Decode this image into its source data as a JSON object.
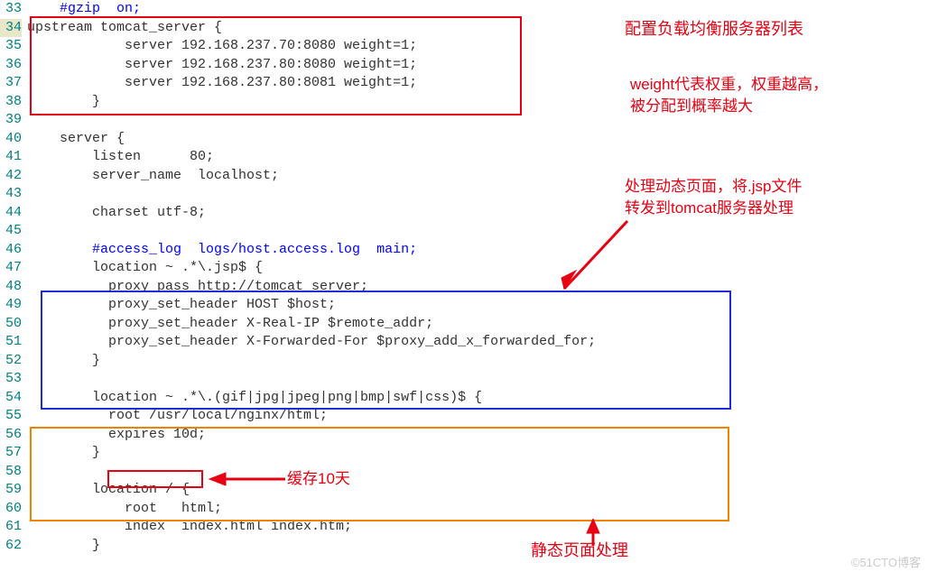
{
  "line_numbers": {
    "start": 33,
    "end": 62,
    "highlight": 34
  },
  "code_lines": [
    "    #gzip  on;",
    "upstream tomcat_server {",
    "            server 192.168.237.70:8080 weight=1;",
    "            server 192.168.237.80:8080 weight=1;",
    "            server 192.168.237.80:8081 weight=1;",
    "        }",
    "",
    "    server {",
    "        listen      80;",
    "        server_name  localhost;",
    "",
    "        charset utf-8;",
    "",
    "        #access_log  logs/host.access.log  main;",
    "        location ~ .*\\.jsp$ {",
    "          proxy_pass http://tomcat_server;",
    "          proxy_set_header HOST $host;",
    "          proxy_set_header X-Real-IP $remote_addr;",
    "          proxy_set_header X-Forwarded-For $proxy_add_x_forwarded_for;",
    "        }",
    "",
    "        location ~ .*\\.(gif|jpg|jpeg|png|bmp|swf|css)$ {",
    "          root /usr/local/nginx/html;",
    "          expires 10d;",
    "        }",
    "",
    "        location / {",
    "            root   html;",
    "            index  index.html index.htm;",
    "        }"
  ],
  "blue_class_indexes": [
    0,
    13
  ],
  "annotations": {
    "a1": "配置负载均衡服务器列表",
    "a2": "weight代表权重，权重越高，\n被分配到概率越大",
    "a3": "处理动态页面，将.jsp文件\n转发到tomcat服务器处理",
    "a4": "缓存10天",
    "a5": "静态页面处理"
  },
  "watermark": "©51CTO博客"
}
